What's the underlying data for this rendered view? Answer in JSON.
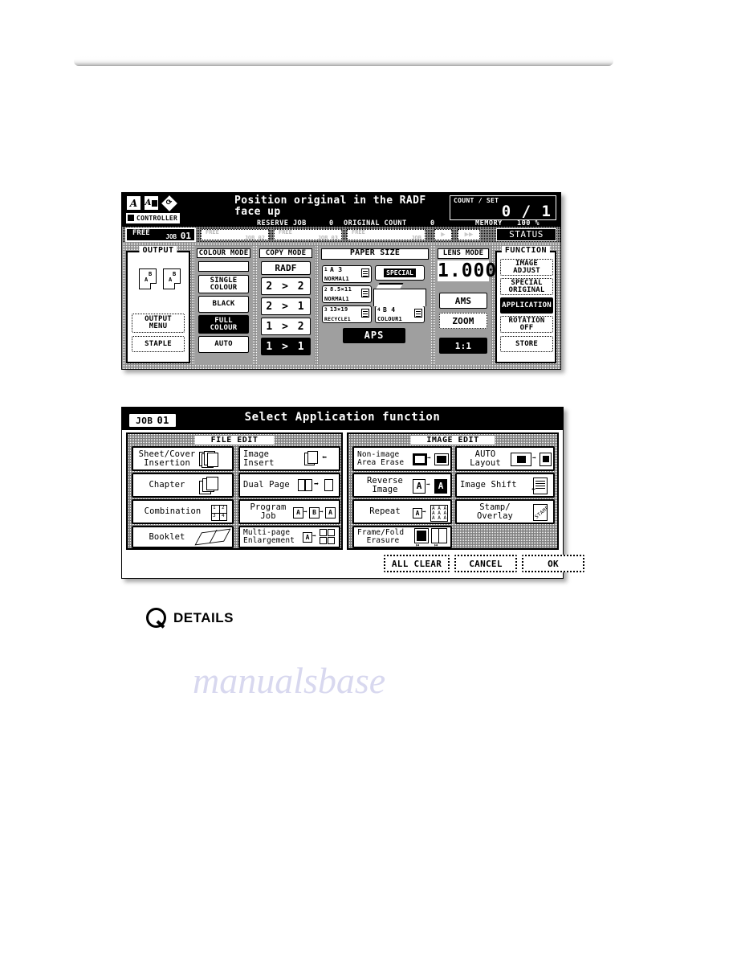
{
  "page": {
    "details_label": "DETAILS",
    "details_icon": "magnifier-icon"
  },
  "basic_screen": {
    "header": {
      "icons": [
        "original-orientation-icon",
        "original-image-icon",
        "rotate-icon"
      ],
      "controller_tag": "CONTROLLER",
      "message_line1": "Position original in the RADF",
      "message_line2": "face up",
      "count_label": "COUNT / SET",
      "count_value": "0 / 1"
    },
    "status": {
      "reserve_job_label": "RESERVE JOB",
      "reserve_job_value": "0",
      "original_count_label": "ORIGINAL COUNT",
      "original_count_value": "0",
      "memory_label": "MEMORY",
      "memory_value": "100 %"
    },
    "job_tabs": {
      "active": {
        "state": "FREE",
        "job_label": "JOB",
        "number": "01"
      },
      "free": [
        {
          "state": "FREE",
          "job_label": "JOB 02"
        },
        {
          "state": "FREE",
          "job_label": "JOB 03"
        },
        {
          "state": "FREE",
          "job_label": "JOB"
        }
      ],
      "next_arrow": "▶",
      "last_arrow": "▶▶",
      "status_button": "STATUS"
    },
    "output": {
      "title": "OUTPUT",
      "page_letters": [
        "B",
        "A",
        "B",
        "A"
      ],
      "buttons": [
        {
          "label": "OUTPUT MENU",
          "selected": false
        },
        {
          "label": "STAPLE",
          "selected": false
        }
      ]
    },
    "colour_mode": {
      "title": "COLOUR MODE",
      "buttons": [
        {
          "label": "SINGLE COLOUR",
          "selected": false
        },
        {
          "label": "BLACK",
          "selected": false
        },
        {
          "label": "FULL COLOUR",
          "selected": true
        },
        {
          "label": "AUTO",
          "selected": false
        }
      ]
    },
    "copy_mode": {
      "title": "COPY MODE",
      "source": "RADF",
      "buttons": [
        {
          "label": "2 > 2",
          "selected": false
        },
        {
          "label": "2 > 1",
          "selected": false
        },
        {
          "label": "1 > 2",
          "selected": false
        },
        {
          "label": "1 > 1",
          "selected": true
        }
      ]
    },
    "paper_size": {
      "title": "PAPER SIZE",
      "trays": [
        {
          "num": "1",
          "size": "A 3",
          "type": "NORMAL1"
        },
        {
          "num": "2",
          "size": "8.5×11",
          "type": "NORMAL1"
        },
        {
          "num": "3",
          "size": "13×19",
          "type": "RECYCLE1"
        },
        {
          "num": "4",
          "size": "B 4",
          "type": "COLOUR1"
        }
      ],
      "special_label": "SPECIAL",
      "aps_label": "APS",
      "aps_selected": true
    },
    "lens_mode": {
      "title": "LENS MODE",
      "value": "1.000",
      "buttons": [
        {
          "label": "AMS",
          "selected": false
        },
        {
          "label": "ZOOM",
          "selected": false
        },
        {
          "label": "1:1",
          "selected": true
        }
      ]
    },
    "function": {
      "title": "FUNCTION",
      "buttons": [
        {
          "label": "IMAGE ADJUST",
          "selected": false
        },
        {
          "label": "SPECIAL ORIGINAL",
          "selected": false
        },
        {
          "label": "APPLICATION",
          "selected": true
        },
        {
          "label": "ROTATION OFF",
          "selected": false
        },
        {
          "label": "STORE",
          "selected": false
        }
      ]
    }
  },
  "application_screen": {
    "title": "Select Application function",
    "job_chip": {
      "label": "JOB",
      "number": "01"
    },
    "file_edit": {
      "title": "FILE EDIT",
      "items": [
        {
          "label": "Sheet/Cover Insertion",
          "icon": "sheet-cover-insertion-icon"
        },
        {
          "label": "Image Insert",
          "icon": "image-insert-icon"
        },
        {
          "label": "Chapter",
          "icon": "chapter-icon"
        },
        {
          "label": "Dual Page",
          "icon": "dual-page-icon"
        },
        {
          "label": "Combination",
          "icon": "combination-icon"
        },
        {
          "label": "Program Job",
          "icon": "program-job-icon"
        },
        {
          "label": "Booklet",
          "icon": "booklet-icon"
        },
        {
          "label": "Multi-page Enlargement",
          "icon": "multi-page-enlargement-icon"
        }
      ]
    },
    "image_edit": {
      "title": "IMAGE EDIT",
      "items": [
        {
          "label": "Non-image Area Erase",
          "icon": "non-image-area-erase-icon"
        },
        {
          "label": "AUTO Layout",
          "icon": "auto-layout-icon"
        },
        {
          "label": "Reverse Image",
          "icon": "reverse-image-icon"
        },
        {
          "label": "Image Shift",
          "icon": "image-shift-icon"
        },
        {
          "label": "Repeat",
          "icon": "repeat-icon"
        },
        {
          "label": "Stamp/ Overlay",
          "icon": "stamp-overlay-icon"
        },
        {
          "label": "Frame/Fold Erasure",
          "icon": "frame-fold-erasure-icon"
        }
      ]
    },
    "actions": [
      {
        "label": "ALL CLEAR",
        "style": "dotted"
      },
      {
        "label": "CANCEL",
        "style": "dotted"
      },
      {
        "label": "OK",
        "style": "dotted"
      }
    ]
  }
}
